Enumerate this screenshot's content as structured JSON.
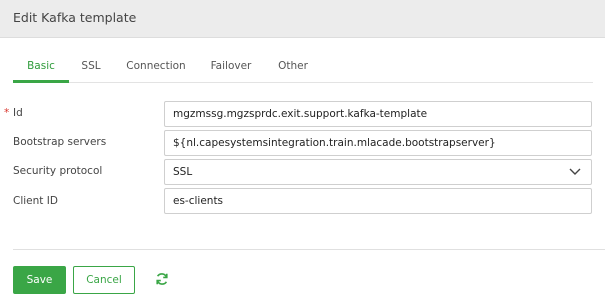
{
  "header": {
    "title": "Edit Kafka template"
  },
  "tabs": [
    {
      "label": "Basic",
      "active": true
    },
    {
      "label": "SSL",
      "active": false
    },
    {
      "label": "Connection",
      "active": false
    },
    {
      "label": "Failover",
      "active": false
    },
    {
      "label": "Other",
      "active": false
    }
  ],
  "form": {
    "id": {
      "label": "Id",
      "required_marker": "*",
      "value": "mgzmssg.mgzsprdc.exit.support.kafka-template"
    },
    "bootstrap": {
      "label": "Bootstrap servers",
      "value": "${nl.capesystemsintegration.train.mlacade.bootstrapserver}"
    },
    "security": {
      "label": "Security protocol",
      "value": "SSL"
    },
    "client": {
      "label": "Client ID",
      "value": "es-clients"
    }
  },
  "footer": {
    "save_label": "Save",
    "cancel_label": "Cancel"
  },
  "colors": {
    "accent": "#3aa646",
    "required": "#d9342b"
  },
  "icons": {
    "dropdown": "chevron-down-icon",
    "refresh": "refresh-icon"
  }
}
